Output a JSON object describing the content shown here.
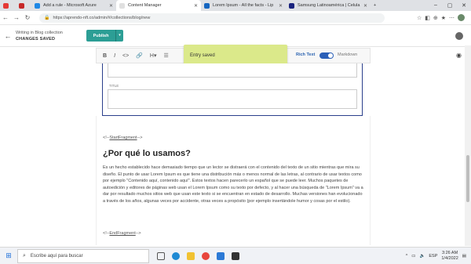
{
  "browser": {
    "tabs": [
      {
        "label": "",
        "color": "#e53935"
      },
      {
        "label": "",
        "color": "#c62828"
      },
      {
        "label": "Add a rule - Microsoft Azure",
        "color": "#1e88e5"
      },
      {
        "label": "Content Manager",
        "color": "#ffffff",
        "active": true
      },
      {
        "label": "Lorem Ipsum - All the facts - Lip",
        "color": "#1565c0"
      },
      {
        "label": "Samsung Latinoamérica | Celula",
        "color": "#1a237e"
      }
    ],
    "new_tab_label": "+",
    "url": "https://aprendo-nft.co/admin/#/collections/blog/new"
  },
  "app": {
    "breadcrumb_title": "Writing in Blog collection",
    "status": "CHANGES SAVED",
    "publish_label": "Publish",
    "toast": "Entry saved",
    "rich_text_label": "Rich Text",
    "markdown_label": "Markdown",
    "title_field_label": "TITLE",
    "toolbar_icons": [
      "bold-icon",
      "italic-icon",
      "code-icon",
      "link-icon",
      "heading-icon",
      "bulleted-list-icon"
    ]
  },
  "content": {
    "start_fragment_prefix": "<!--",
    "start_fragment": "StartFragment",
    "start_fragment_suffix": "-->",
    "heading": "¿Por qué lo usamos?",
    "paragraph": "Es un hecho establecido hace demasiado tiempo que un lector se distraerá con el contenido del texto de un sitio mientras que mira su diseño. El punto de usar Lorem Ipsum es que tiene una distribución más o menos normal de las letras, al contrario de usar textos como por ejemplo \"Contenido aquí, contenido aquí\". Estos textos hacen parecerlo un español que se puede leer. Muchos paquetes de autoedición y editores de páginas web usan el Lorem Ipsum como su texto por defecto, y al hacer una búsqueda de \"Lorem Ipsum\" va a dar por resultado muchos sitios web que usan este texto si se encuentran en estado de desarrollo. Muchas versiones han evolucionado a través de los años, algunas veces por accidente, otras veces a propósito (por ejemplo insertándole humor y cosas por el estilo).",
    "end_fragment_prefix": "<!--",
    "end_fragment": "EndFragment",
    "end_fragment_suffix": "-->"
  },
  "taskbar": {
    "search_placeholder": "Escribe aquí para buscar",
    "time": "3:26 AM",
    "date": "1/4/2022",
    "language": "ESP"
  }
}
